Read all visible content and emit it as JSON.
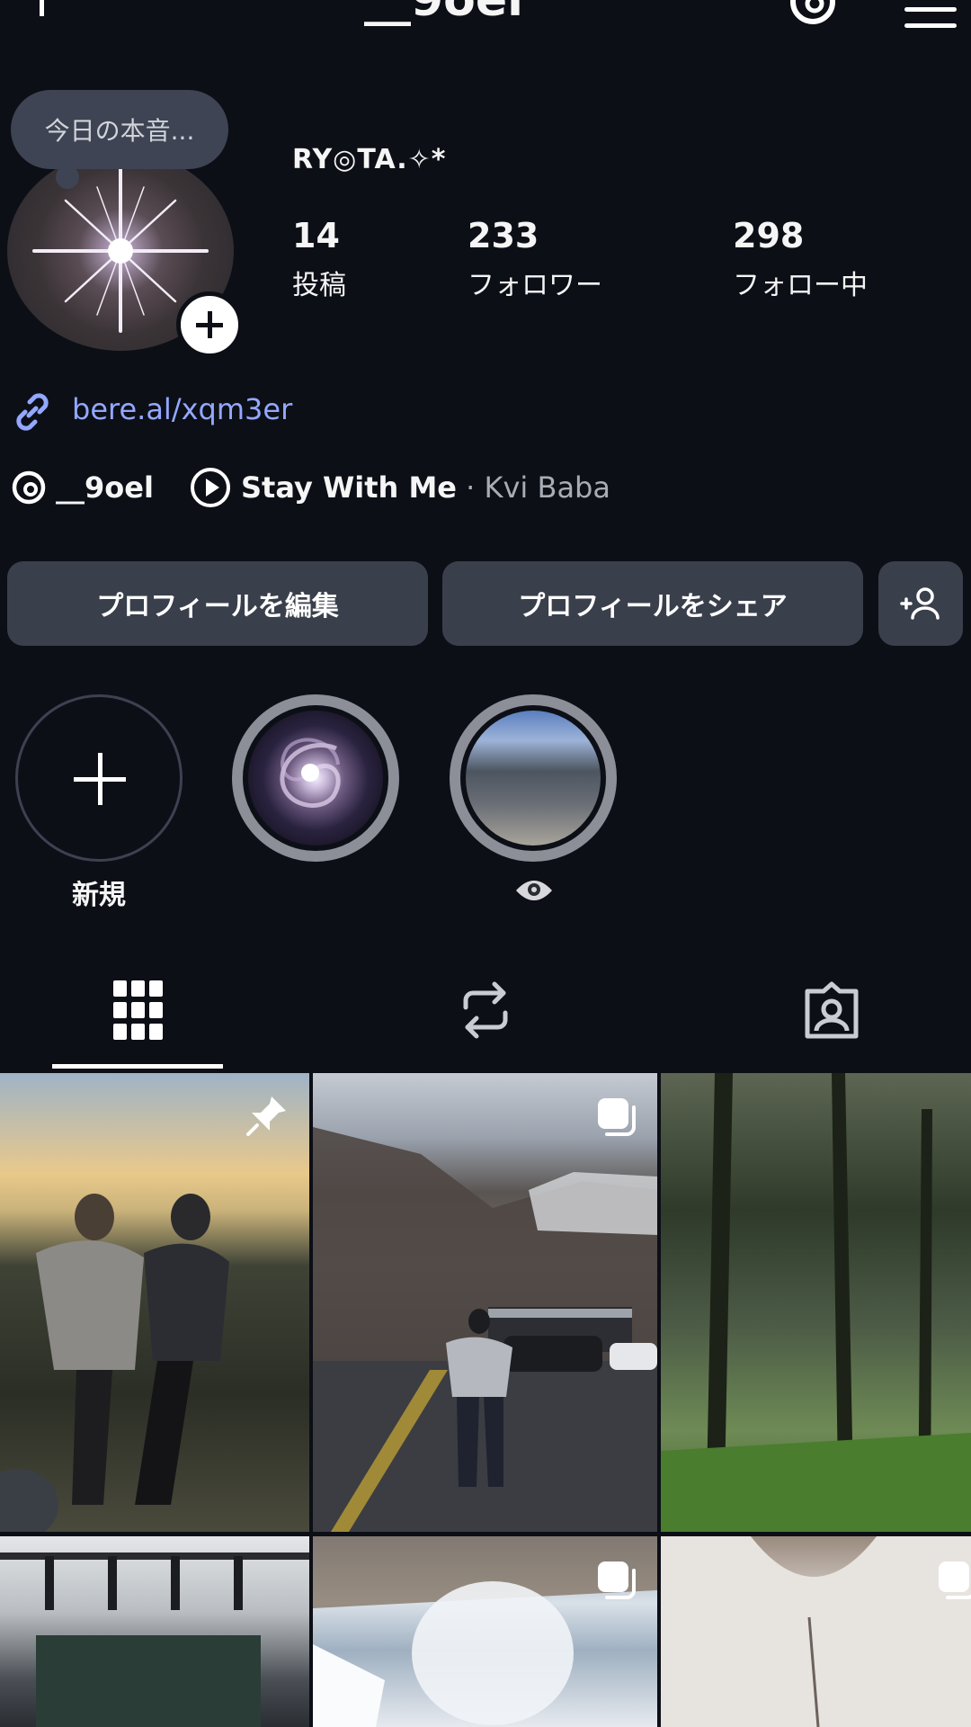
{
  "header": {
    "username": "__9oel"
  },
  "profile": {
    "note": "今日の本音...",
    "display_name": "RY◎TA.✧*",
    "stats": [
      {
        "value": "14",
        "label": "投稿"
      },
      {
        "value": "233",
        "label": "フォロワー"
      },
      {
        "value": "298",
        "label": "フォロー中"
      }
    ],
    "link": "bere.al/xqm3er",
    "threads_handle": "__9oel",
    "music": {
      "title": "Stay With Me",
      "artist": " · Kvi Baba"
    }
  },
  "buttons": {
    "edit": "プロフィールを編集",
    "share": "プロフィールをシェア"
  },
  "highlights": [
    {
      "label": "新規"
    },
    {
      "label": ""
    },
    {
      "label": ""
    }
  ],
  "icons": {
    "pin": "pin-icon",
    "carousel": "carousel-icon",
    "grid": "grid-icon",
    "reposts": "repost-icon",
    "tagged": "tagged-icon"
  }
}
